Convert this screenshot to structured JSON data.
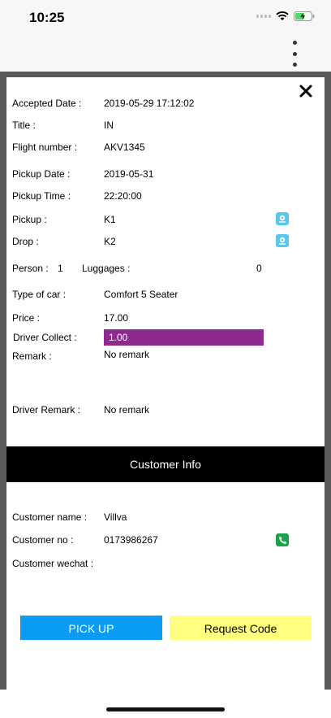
{
  "status_bar": {
    "time": "10:25"
  },
  "details": {
    "accepted_date": {
      "label": "Accepted Date :",
      "value": "2019-05-29 17:12:02"
    },
    "title": {
      "label": "Title :",
      "value": "IN"
    },
    "flight_number": {
      "label": "Flight number :",
      "value": "AKV1345"
    },
    "pickup_date": {
      "label": "Pickup Date :",
      "value": "2019-05-31"
    },
    "pickup_time": {
      "label": "Pickup Time :",
      "value": "22:20:00"
    },
    "pickup": {
      "label": "Pickup :",
      "value": "K1"
    },
    "drop": {
      "label": "Drop :",
      "value": "K2"
    },
    "person": {
      "label": "Person :",
      "value": "1"
    },
    "luggages": {
      "label": "Luggages :",
      "value": "0"
    },
    "type_of_car": {
      "label": "Type of car :",
      "value": "Comfort 5 Seater"
    },
    "price": {
      "label": "Price :",
      "value": "17.00"
    },
    "driver_collect": {
      "label": "Driver Collect :",
      "value": "1.00"
    },
    "remark": {
      "label": "Remark :",
      "value": "No remark"
    },
    "driver_remark": {
      "label": "Driver Remark :",
      "value": "No remark"
    }
  },
  "customer_section": {
    "title": "Customer Info"
  },
  "customer": {
    "name": {
      "label": "Customer name :",
      "value": "Villva"
    },
    "number": {
      "label": "Customer no :",
      "value": "0173986267"
    },
    "wechat": {
      "label": "Customer wechat :",
      "value": ""
    }
  },
  "actions": {
    "pickup_label": "PICK UP",
    "request_code_label": "Request Code"
  },
  "colors": {
    "accent_blue": "#0a9cf4",
    "request_yellow": "#ffff80",
    "collect_purple": "#8e2a8e",
    "header_black": "#000000"
  }
}
